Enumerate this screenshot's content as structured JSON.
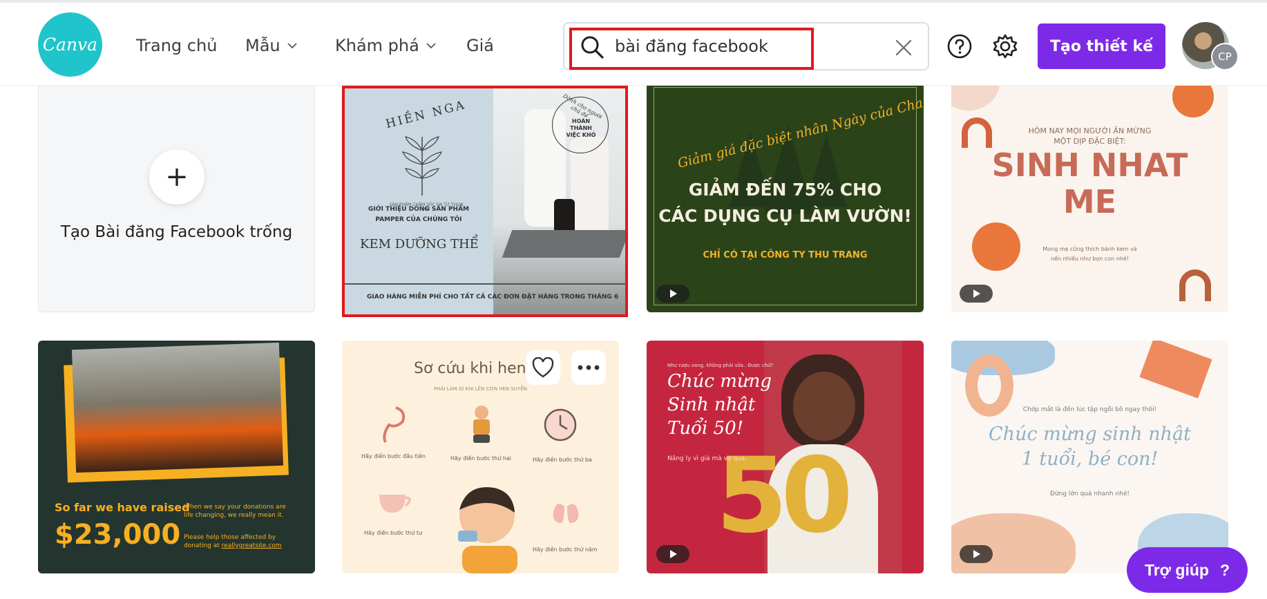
{
  "header": {
    "logo_text": "Canva",
    "nav": [
      {
        "label": "Trang chủ",
        "has_dropdown": false
      },
      {
        "label": "Mẫu",
        "has_dropdown": true
      },
      {
        "label": "Khám phá",
        "has_dropdown": true
      },
      {
        "label": "Giá",
        "has_dropdown": false
      }
    ],
    "search_value": "bài đăng facebook",
    "icons": [
      "help-icon",
      "settings-icon"
    ],
    "create_label": "Tạo thiết kế",
    "avatar_initials": "CP"
  },
  "colors": {
    "brand_teal": "#20c4cb",
    "brand_purple": "#7d2ae8",
    "highlight_red": "#e0191d"
  },
  "blank_card": {
    "label": "Tạo Bài đăng Facebook trống"
  },
  "templates": {
    "t1": {
      "brand": "HIỀN NGA",
      "tagline": "SẢN PHẨM CHĂM SÓC DA TỪ THỰC VẬT",
      "stamp_arc": "Dành cho người chủ để",
      "stamp_center": "HOÀN THÀNH VIỆC KHÓ",
      "intro": "GIỚI THIỆU DÒNG SẢN PHẨM PAMPER CỦA CHÚNG TÔI",
      "product": "KEM DƯỠNG THỂ",
      "footer": "GIAO HÀNG MIỄN PHÍ CHO TẤT CẢ CÁC ĐƠN ĐẶT HÀNG TRONG THÁNG 6"
    },
    "t2": {
      "arc": "Giảm giá đặc biệt nhân Ngày của Cha",
      "line1": "GIẢM ĐẾN 75% CHO",
      "line2": "CÁC DỤNG CỤ LÀM VƯỜN!",
      "footer": "CHỈ CÓ TẠI CÔNG TY THU TRANG"
    },
    "t3": {
      "top1": "HÔM NAY MỌI NGƯỜI ĂN MỪNG",
      "top2": "MỘT DỊP ĐẶC BIỆT:",
      "title1": "SINH NHAT",
      "title2": "ME",
      "small1": "Mong mẹ cũng thích bánh kem và",
      "small2": "nến nhiều như bọn con nhé!"
    },
    "t4": {
      "raised": "So far we have raised",
      "amount": "$23,000",
      "note1": "When we say your donations are",
      "note2": "life changing, we really mean it.",
      "note3": "Please help those affected by",
      "note4": "donating at ",
      "link": "reallygreatsite.com"
    },
    "t5": {
      "title": "Sơ cứu khi hen su",
      "subtitle": "PHẢI LÀM GÌ KHI LÊN CƠN HEN SUYỄN",
      "steps": [
        "Hãy điền bước đầu tiên",
        "Hãy điền bước thứ hai",
        "Hãy điền bước thứ ba",
        "Hãy điền bước thứ tư",
        "Hãy điền bước thứ năm"
      ]
    },
    "t6": {
      "top": "Như rượu vang, không phải sữa.. Được chứ?",
      "line1": "Chúc mừng",
      "line2": "Sinh nhật",
      "line3": "Tuổi 50!",
      "sub": "Nâng ly vì giá mà vợ qua.",
      "balloon": "50"
    },
    "t7": {
      "top": "Chớp mắt là đến lúc tập ngồi bô ngay thôi!",
      "line1": "Chúc mừng sinh nhật",
      "line2": "1 tuổi, bé con!",
      "bottom": "Đừng lớn quá nhanh nhé!"
    }
  },
  "help_button": {
    "label": "Trợ giúp",
    "icon": "?"
  }
}
